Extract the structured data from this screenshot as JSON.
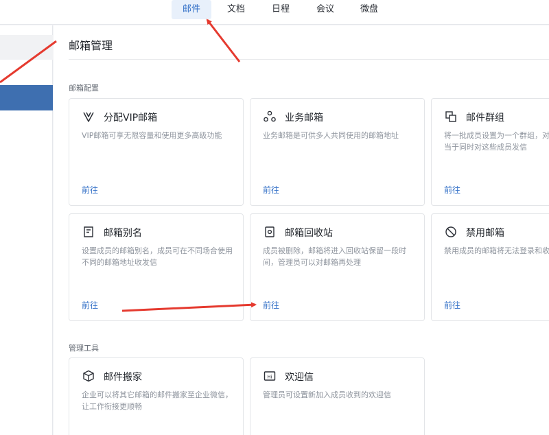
{
  "topnav": {
    "tabs": [
      {
        "label": "邮件"
      },
      {
        "label": "文档"
      },
      {
        "label": "日程"
      },
      {
        "label": "会议"
      },
      {
        "label": "微盘"
      }
    ]
  },
  "main": {
    "title": "邮箱管理",
    "sections": [
      {
        "label": "邮箱配置",
        "cards": [
          {
            "title": "分配VIP邮箱",
            "icon": "vip-icon",
            "desc": "VIP邮箱可享无限容量和使用更多高级功能",
            "link": "前往"
          },
          {
            "title": "业务邮箱",
            "icon": "business-mailbox-icon",
            "desc": "业务邮箱是可供多人共同使用的邮箱地址",
            "link": "前往"
          },
          {
            "title": "邮件群组",
            "icon": "mail-group-icon",
            "desc": "将一批成员设置为一个群组，对",
            "desc2": "当于同时对这些成员发信",
            "link": "前往"
          },
          {
            "title": "邮箱别名",
            "icon": "alias-icon",
            "desc": "设置成员的邮箱别名，成员可在不同场合使用不同的邮箱地址收发信",
            "link": "前往"
          },
          {
            "title": "邮箱回收站",
            "icon": "recycle-bin-icon",
            "desc": "成员被删除，邮箱将进入回收站保留一段时间，管理员可以对邮箱再处理",
            "link": "前往"
          },
          {
            "title": "禁用邮箱",
            "icon": "disable-icon",
            "desc": "禁用成员的邮箱将无法登录和收",
            "link": "前往"
          }
        ]
      },
      {
        "label": "管理工具",
        "cards": [
          {
            "title": "邮件搬家",
            "icon": "cube-icon",
            "desc": "企业可以将其它邮箱的邮件搬家至企业微信，让工作衔接更顺畅"
          },
          {
            "title": "欢迎信",
            "icon": "welcome-letter-icon",
            "desc": "管理员可设置新加入成员收到的欢迎信"
          }
        ]
      }
    ]
  },
  "colors": {
    "accent": "#3370c7",
    "annotation_arrow": "#e53a2f"
  }
}
